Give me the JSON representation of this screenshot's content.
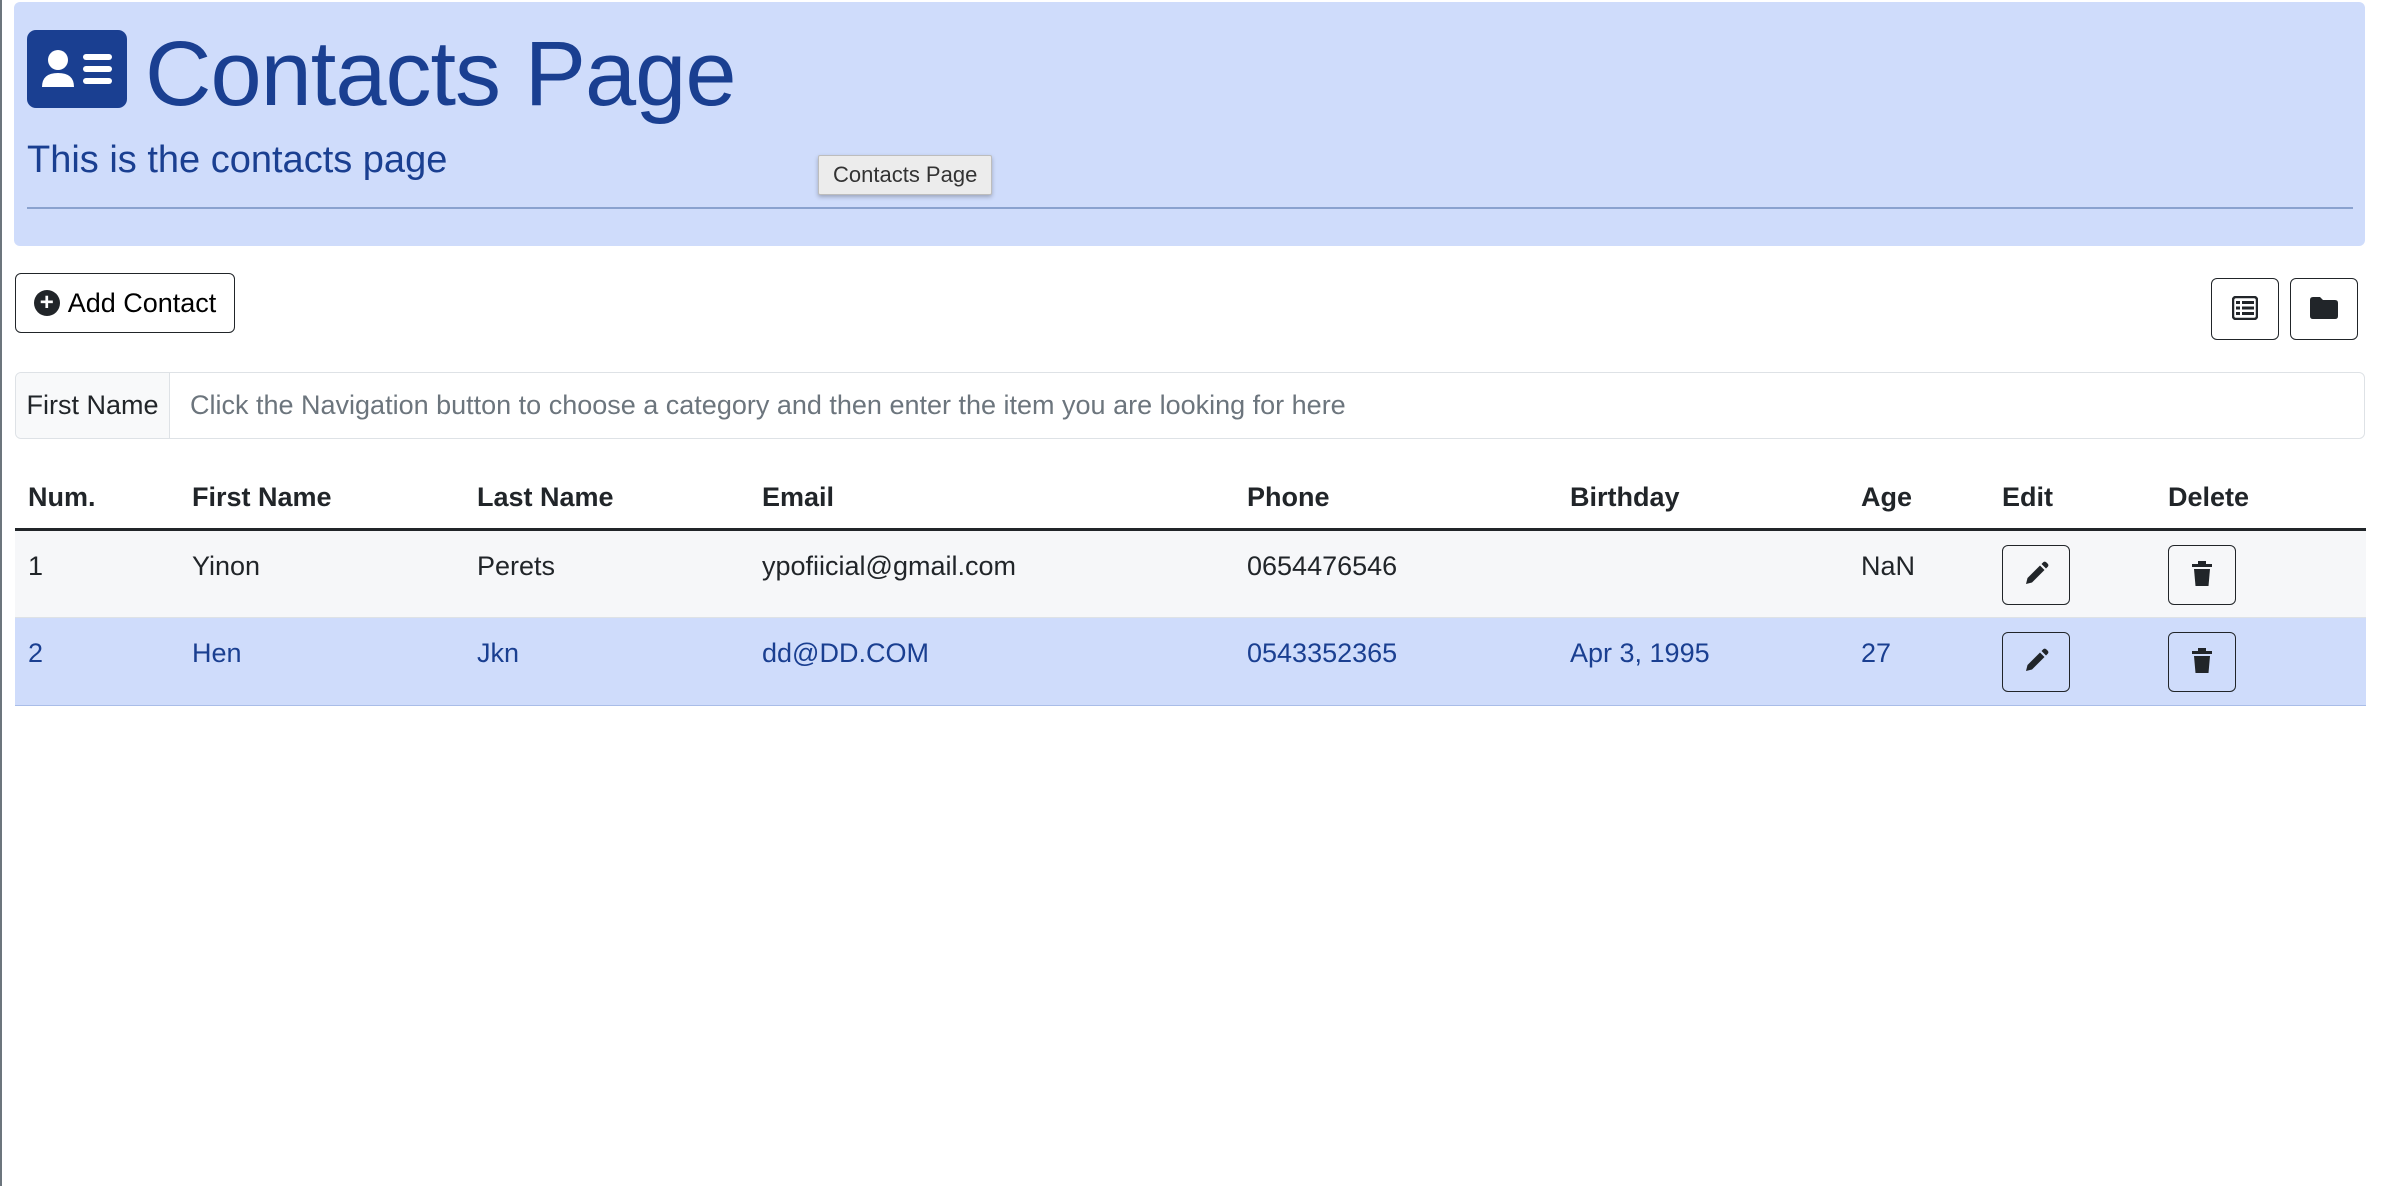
{
  "header": {
    "title": "Contacts Page",
    "subtitle": "This is the contacts page",
    "tooltip": "Contacts Page",
    "bg_color": "#cfdcfb",
    "text_color": "#1a3f91",
    "icon": "address-card-icon"
  },
  "toolbar": {
    "add_label": "Add Contact",
    "add_icon": "plus-circle-icon",
    "view_buttons": [
      "table-view-icon",
      "folder-view-icon"
    ]
  },
  "search": {
    "label": "First Name",
    "placeholder": "Click the Navigation button to choose a category and then enter the item you are looking for here",
    "value": ""
  },
  "table": {
    "columns": [
      "Num.",
      "First Name",
      "Last Name",
      "Email",
      "Phone",
      "Birthday",
      "Age",
      "Edit",
      "Delete"
    ],
    "rows": [
      {
        "num": "1",
        "first": "Yinon",
        "last": "Perets",
        "email": "ypofiicial@gmail.com",
        "phone": "0654476546",
        "birthday": "",
        "age": "NaN",
        "active": false
      },
      {
        "num": "2",
        "first": "Hen",
        "last": "Jkn",
        "email": "dd@DD.COM",
        "phone": "0543352365",
        "birthday": "Apr 3, 1995",
        "age": "27",
        "active": true
      }
    ],
    "edit_icon": "pencil-icon",
    "delete_icon": "trash-icon"
  }
}
